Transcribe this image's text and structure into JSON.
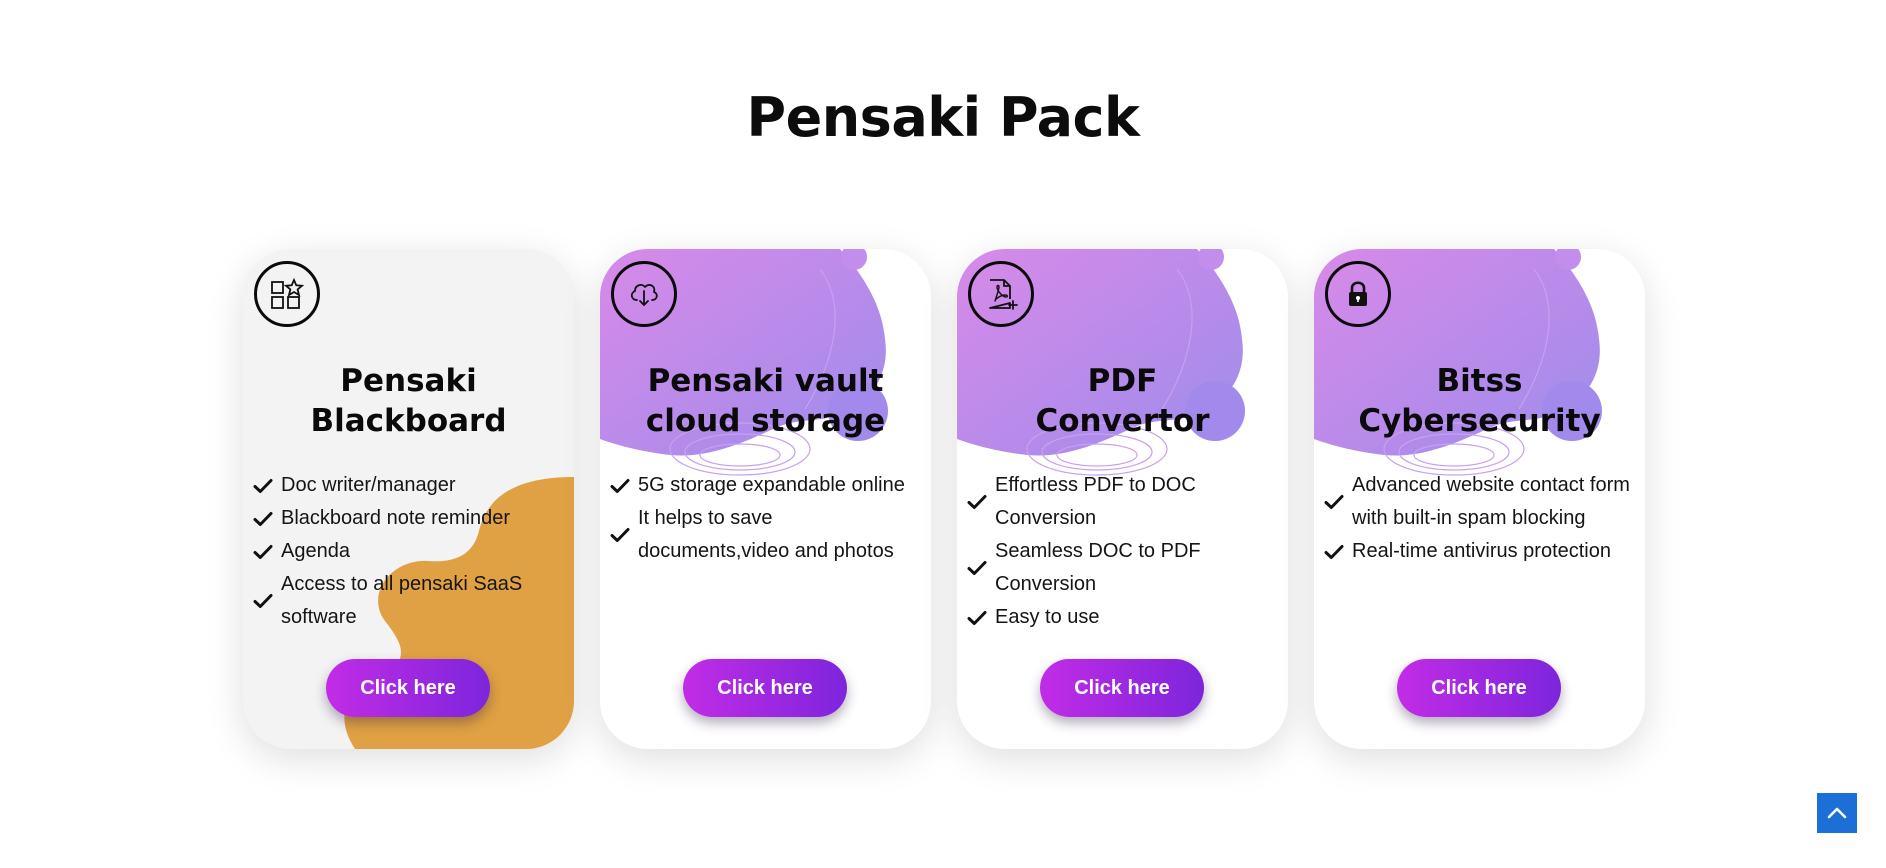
{
  "section": {
    "title": "Pensaki Pack"
  },
  "colors": {
    "button_gradient_start": "#c22ce6",
    "button_gradient_end": "#7d25dc",
    "blob_orange": "#e0a144",
    "blob_purple": "#b98cf0",
    "scroll_top_bg": "#1c6fd6"
  },
  "cards": [
    {
      "icon": "apps-star-icon",
      "title_line1": "Pensaki",
      "title_line2": "Blackboard",
      "features": [
        "Doc writer/manager",
        "Blackboard note reminder",
        "Agenda",
        "Access to all pensaki SaaS software"
      ],
      "button_label": "Click here"
    },
    {
      "icon": "cloud-download-icon",
      "title_line1": "Pensaki vault",
      "title_line2": "cloud storage",
      "features": [
        "5G storage expandable online",
        "It helps to save documents,video and photos"
      ],
      "button_label": "Click here"
    },
    {
      "icon": "pdf-file-icon",
      "title_line1": "PDF",
      "title_line2": "Convertor",
      "features": [
        "Effortless PDF to DOC Conversion",
        "Seamless DOC to PDF Conversion",
        "Easy to use"
      ],
      "button_label": "Click here"
    },
    {
      "icon": "lock-icon",
      "title_line1": "Bitss",
      "title_line2": "Cybersecurity",
      "features": [
        "Advanced website contact form with built-in spam blocking",
        "Real-time antivirus protection"
      ],
      "button_label": "Click here"
    }
  ],
  "scroll_top": {
    "icon": "chevron-up-icon"
  }
}
